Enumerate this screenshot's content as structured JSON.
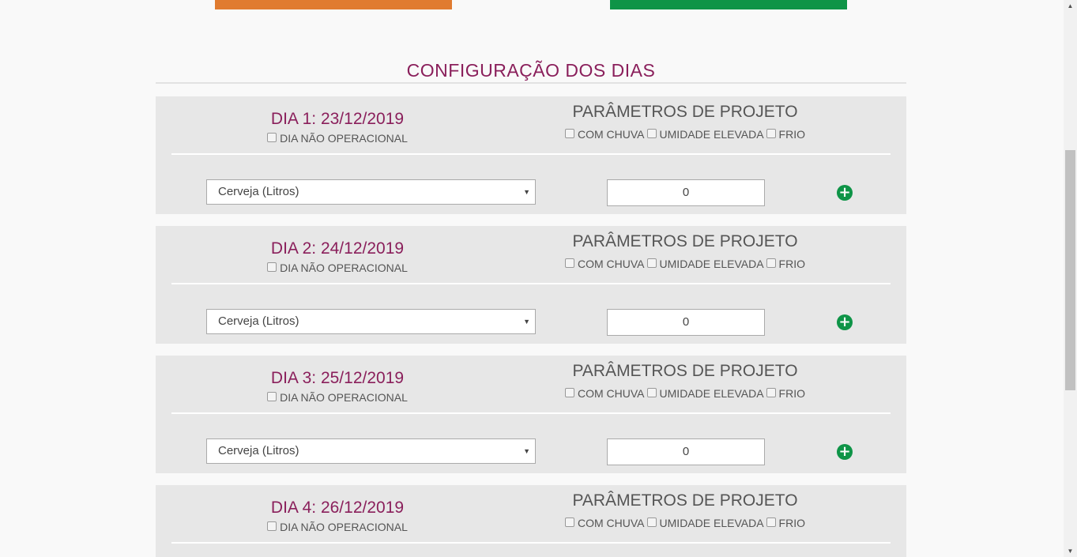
{
  "section": {
    "title": "CONFIGURAÇÃO DOS DIAS"
  },
  "colors": {
    "accent": "#8a1f5b",
    "green": "#0e9447",
    "orange": "#e07b30",
    "card_bg": "#e7e7e7"
  },
  "labels": {
    "non_operational": "DIA NÃO OPERACIONAL",
    "params_title": "PARÂMETROS DE PROJETO",
    "rain": "COM CHUVA",
    "humidity": "UMIDADE ELEVADA",
    "cold": "FRIO"
  },
  "days": [
    {
      "title": "DIA 1: 23/12/2019",
      "product": "Cerveja (Litros)",
      "quantity": "0"
    },
    {
      "title": "DIA 2: 24/12/2019",
      "product": "Cerveja (Litros)",
      "quantity": "0"
    },
    {
      "title": "DIA 3: 25/12/2019",
      "product": "Cerveja (Litros)",
      "quantity": "0"
    },
    {
      "title": "DIA 4: 26/12/2019"
    }
  ],
  "icons": {
    "add": "plus-circle-icon",
    "dropdown": "caret-down-icon"
  }
}
